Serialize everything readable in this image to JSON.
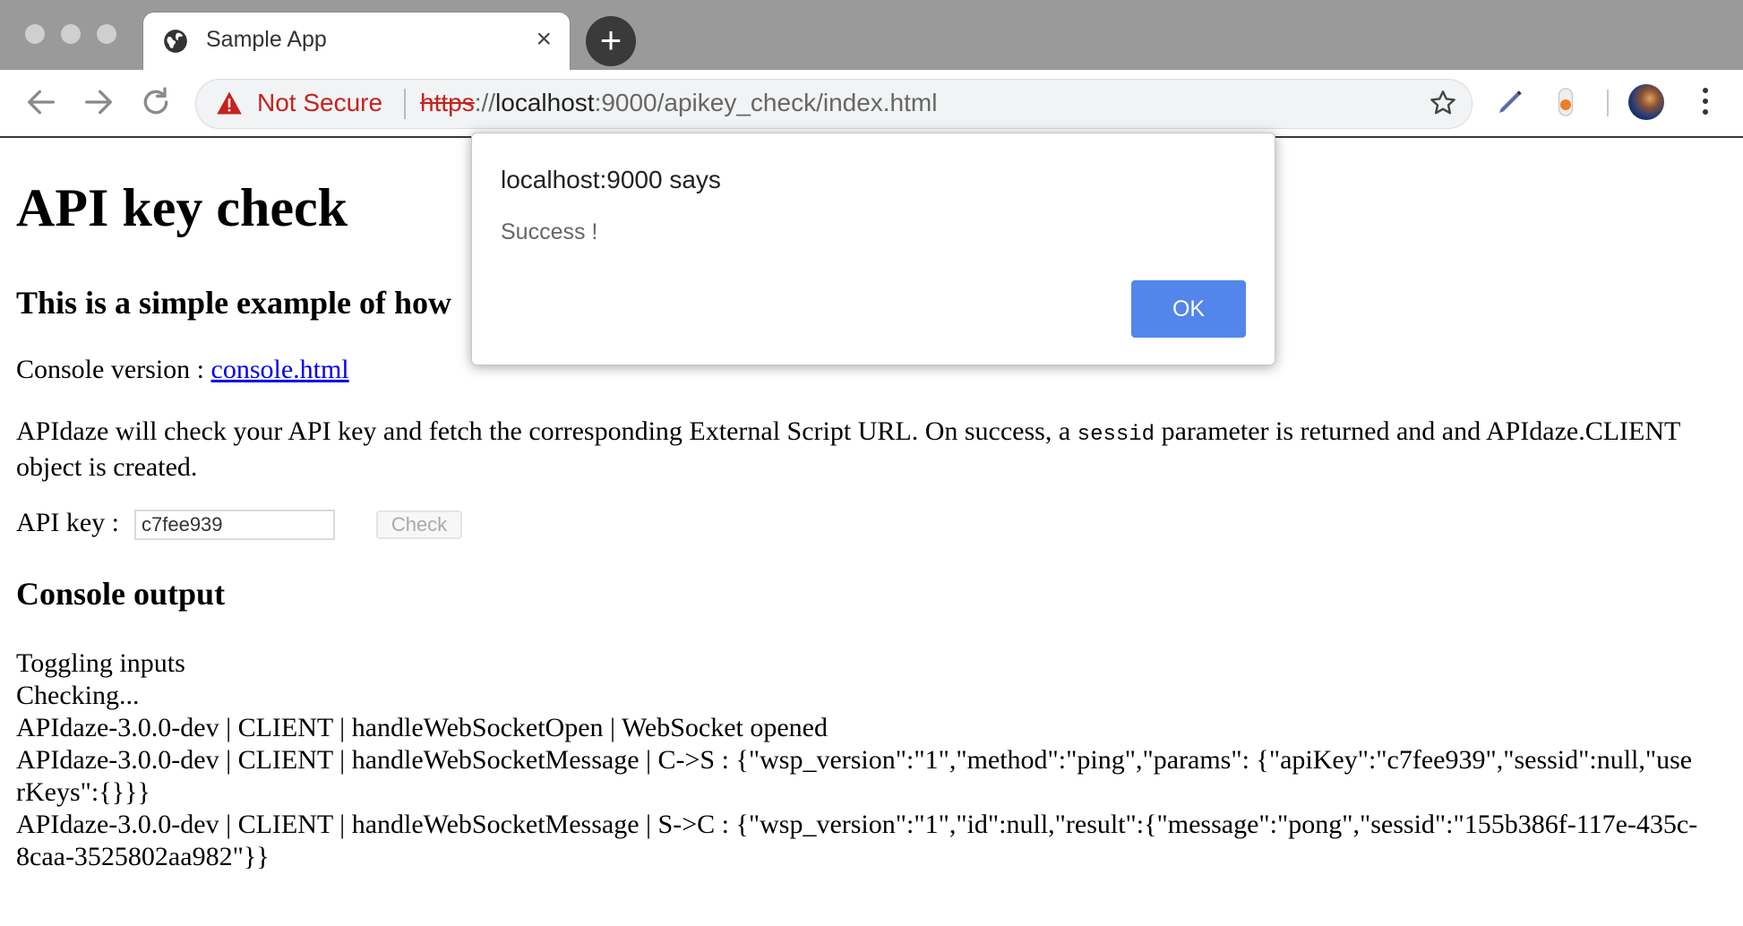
{
  "browser": {
    "tab": {
      "title": "Sample App",
      "close_glyph": "×",
      "icon": "globe-icon"
    },
    "new_tab_glyph": "+",
    "address_bar": {
      "security_label": "Not Secure",
      "url_scheme": "https",
      "url_sep": "://",
      "url_host": "localhost",
      "url_rest": ":9000/apikey_check/index.html"
    },
    "colors": {
      "not_secure": "#c5221f",
      "tabbar": "#9a9a9a"
    }
  },
  "page": {
    "title": "API key check",
    "subtitle": "This is a simple example of how",
    "console_version_label": "Console version : ",
    "console_link": "console.html",
    "description_part1": "APIdaze will check your API key and fetch the corresponding External Script URL. On success, a ",
    "description_code": "sessid",
    "description_part2": " parameter is returned and and APIdaze.CLIENT object is created.",
    "api_key_label": "API key : ",
    "api_key_value": "c7fee939",
    "check_button": "Check",
    "console_output_heading": "Console output",
    "log": [
      "Toggling inputs",
      "Checking...",
      "APIdaze-3.0.0-dev | CLIENT | handleWebSocketOpen | WebSocket opened",
      "APIdaze-3.0.0-dev | CLIENT | handleWebSocketMessage | C->S : {\"wsp_version\":\"1\",\"method\":\"ping\",\"params\": {\"apiKey\":\"c7fee939\",\"sessid\":null,\"userKeys\":{}}}",
      "APIdaze-3.0.0-dev | CLIENT | handleWebSocketMessage | S->C : {\"wsp_version\":\"1\",\"id\":null,\"result\":{\"message\":\"pong\",\"sessid\":\"155b386f-117e-435c-8caa-3525802aa982\"}}"
    ]
  },
  "dialog": {
    "title": "localhost:9000 says",
    "message": "Success !",
    "ok_label": "OK",
    "ok_color": "#5386ea"
  }
}
